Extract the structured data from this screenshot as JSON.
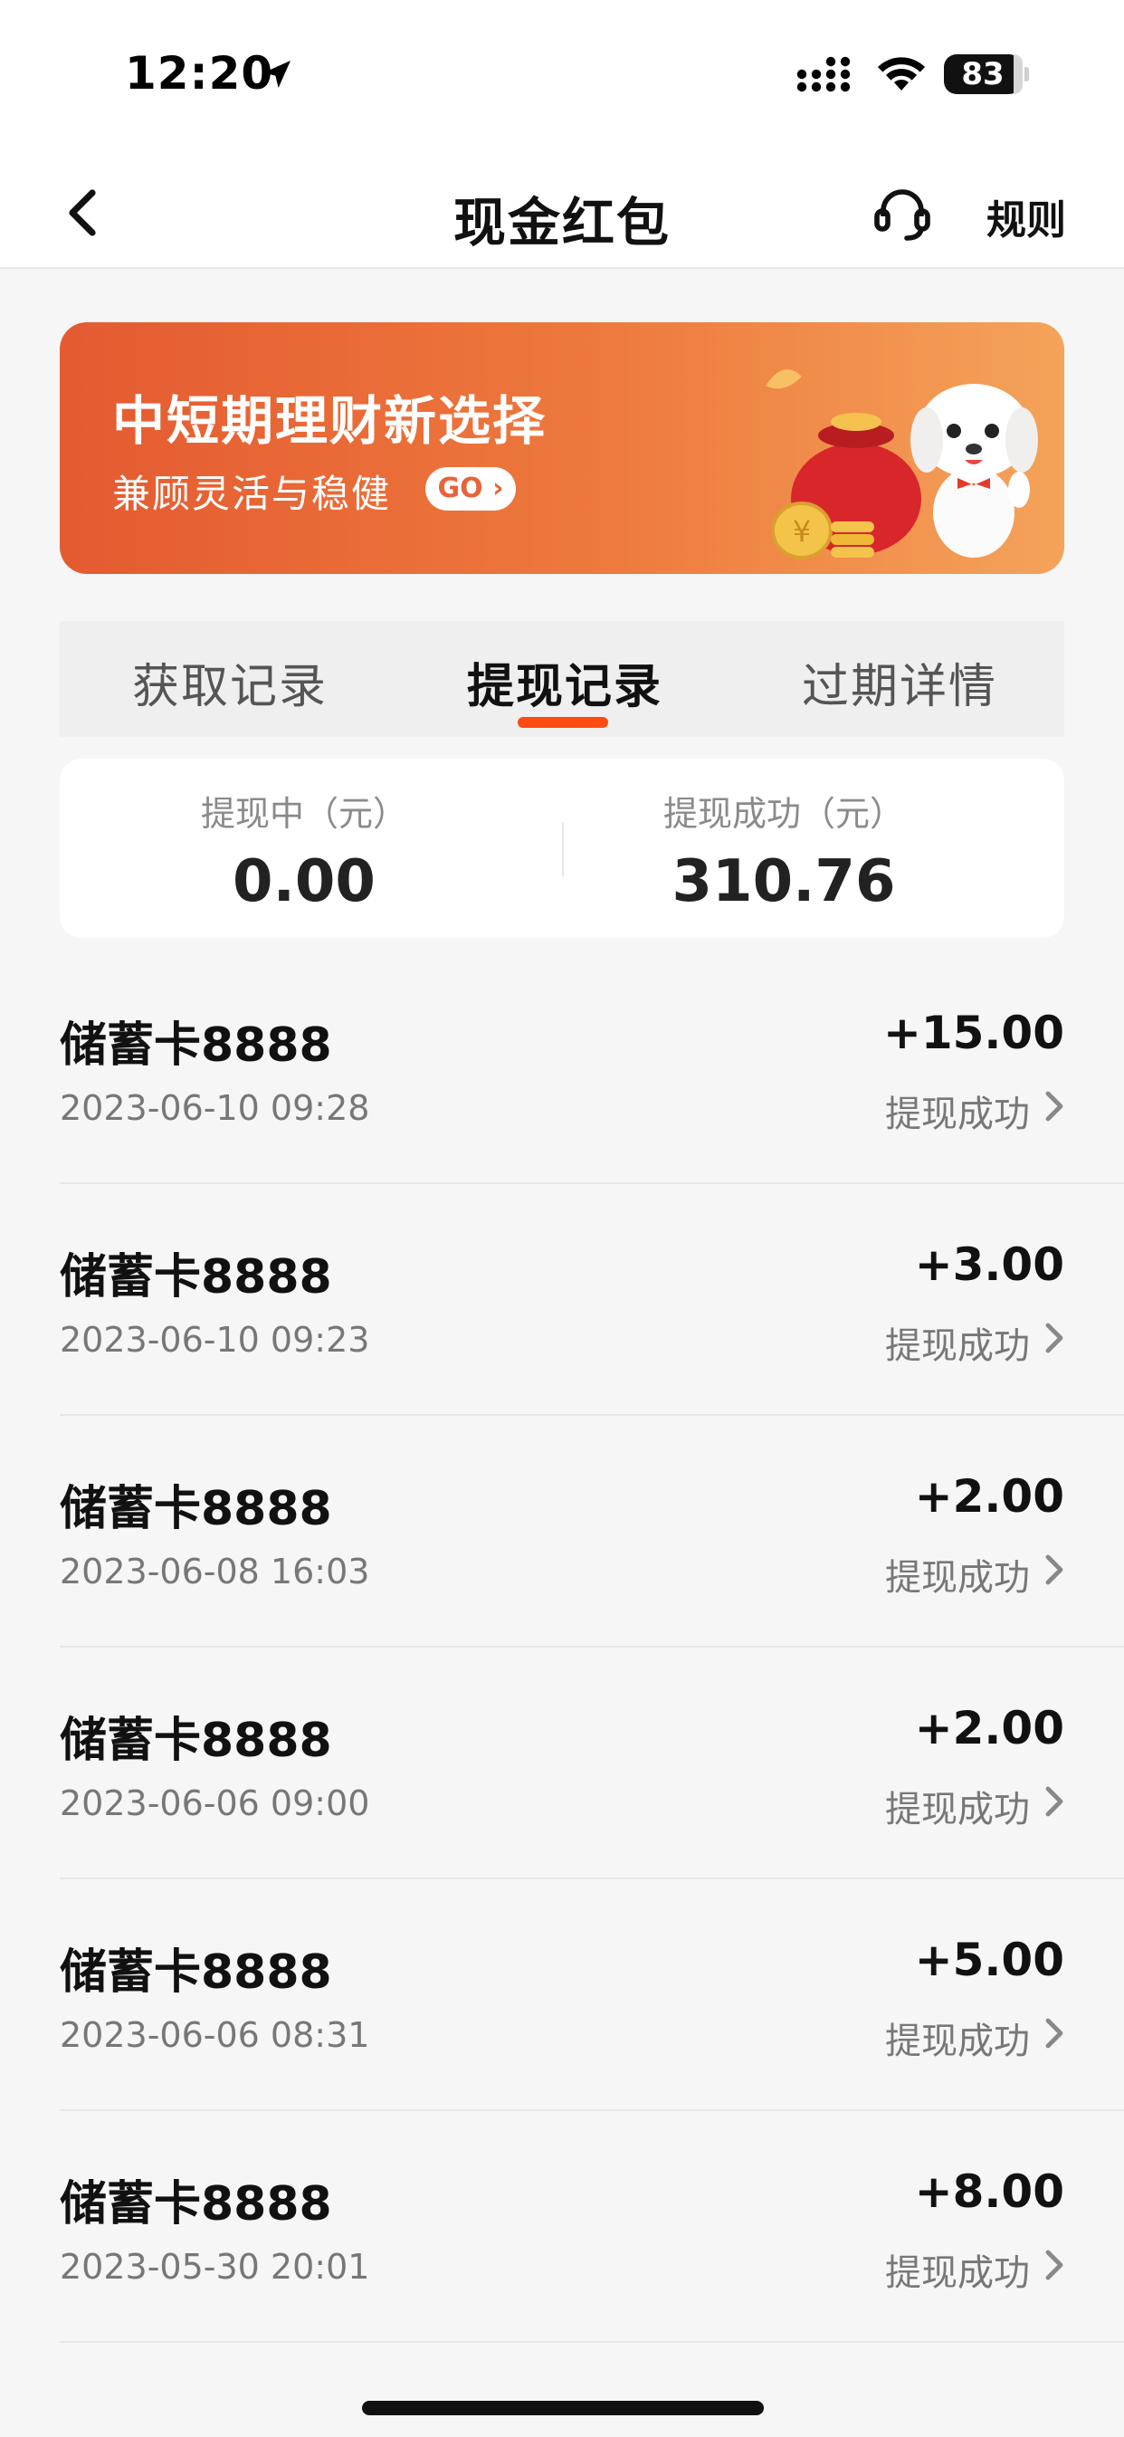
{
  "status_bar": {
    "time": "12:20",
    "battery": "83",
    "icons": [
      "location-arrow-icon",
      "signal-icon",
      "wifi-icon",
      "battery-icon"
    ]
  },
  "nav": {
    "title": "现金红包",
    "rules_label": "规则",
    "icons": [
      "back-icon",
      "headset-icon"
    ]
  },
  "banner": {
    "title": "中短期理财新选择",
    "subtitle": "兼顾灵活与稳健",
    "go_label": "GO ›"
  },
  "tabs": [
    {
      "label": "获取记录",
      "active": false
    },
    {
      "label": "提现记录",
      "active": true
    },
    {
      "label": "过期详情",
      "active": false
    }
  ],
  "summary": {
    "pending_label": "提现中（元）",
    "pending_value": "0.00",
    "success_label": "提现成功（元）",
    "success_value": "310.76"
  },
  "records": [
    {
      "title": "储蓄卡8888",
      "time": "2023-06-10 09:28",
      "amount": "+15.00",
      "status": "提现成功"
    },
    {
      "title": "储蓄卡8888",
      "time": "2023-06-10 09:23",
      "amount": "+3.00",
      "status": "提现成功"
    },
    {
      "title": "储蓄卡8888",
      "time": "2023-06-08 16:03",
      "amount": "+2.00",
      "status": "提现成功"
    },
    {
      "title": "储蓄卡8888",
      "time": "2023-06-06 09:00",
      "amount": "+2.00",
      "status": "提现成功"
    },
    {
      "title": "储蓄卡8888",
      "time": "2023-06-06 08:31",
      "amount": "+5.00",
      "status": "提现成功"
    },
    {
      "title": "储蓄卡8888",
      "time": "2023-05-30 20:01",
      "amount": "+8.00",
      "status": "提现成功"
    }
  ],
  "colors": {
    "accent": "#ff4a12",
    "banner_start": "#e45a31",
    "banner_end": "#f4a35a"
  }
}
